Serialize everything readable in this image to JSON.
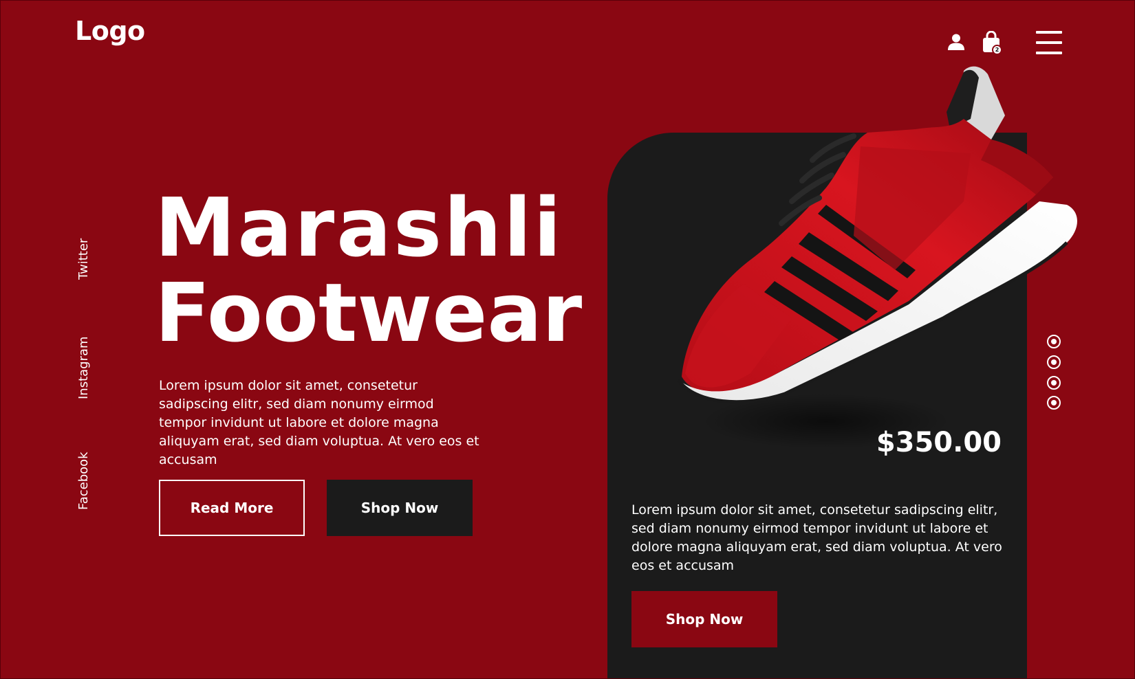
{
  "header": {
    "logo": "Logo",
    "cart_count": "2",
    "icons": [
      "user-icon",
      "shopping-bag-icon",
      "hamburger-menu-icon"
    ]
  },
  "social": {
    "twitter": "Twitter",
    "instagram": "Instagram",
    "facebook": "Facebook"
  },
  "hero": {
    "title_line1": "Marashli",
    "title_line2": "Footwear",
    "description": "Lorem ipsum dolor sit amet, consetetur sadipscing elitr, sed diam nonumy eirmod tempor invidunt ut labore et dolore magna aliquyam erat, sed diam voluptua. At vero eos et accusam",
    "read_more_label": "Read More",
    "shop_now_label": "Shop Now"
  },
  "product": {
    "price": "$350.00",
    "description": "Lorem ipsum dolor sit amet, consetetur sadipscing elitr, sed diam nonumy eirmod tempor invidunt ut labore et dolore magna aliquyam erat, sed diam voluptua. At vero eos et accusam",
    "shop_now_label": "Shop Now"
  },
  "slider": {
    "dot_count": 4
  },
  "colors": {
    "background": "#8a0712",
    "card": "#1b1b1b",
    "text": "#ffffff"
  }
}
